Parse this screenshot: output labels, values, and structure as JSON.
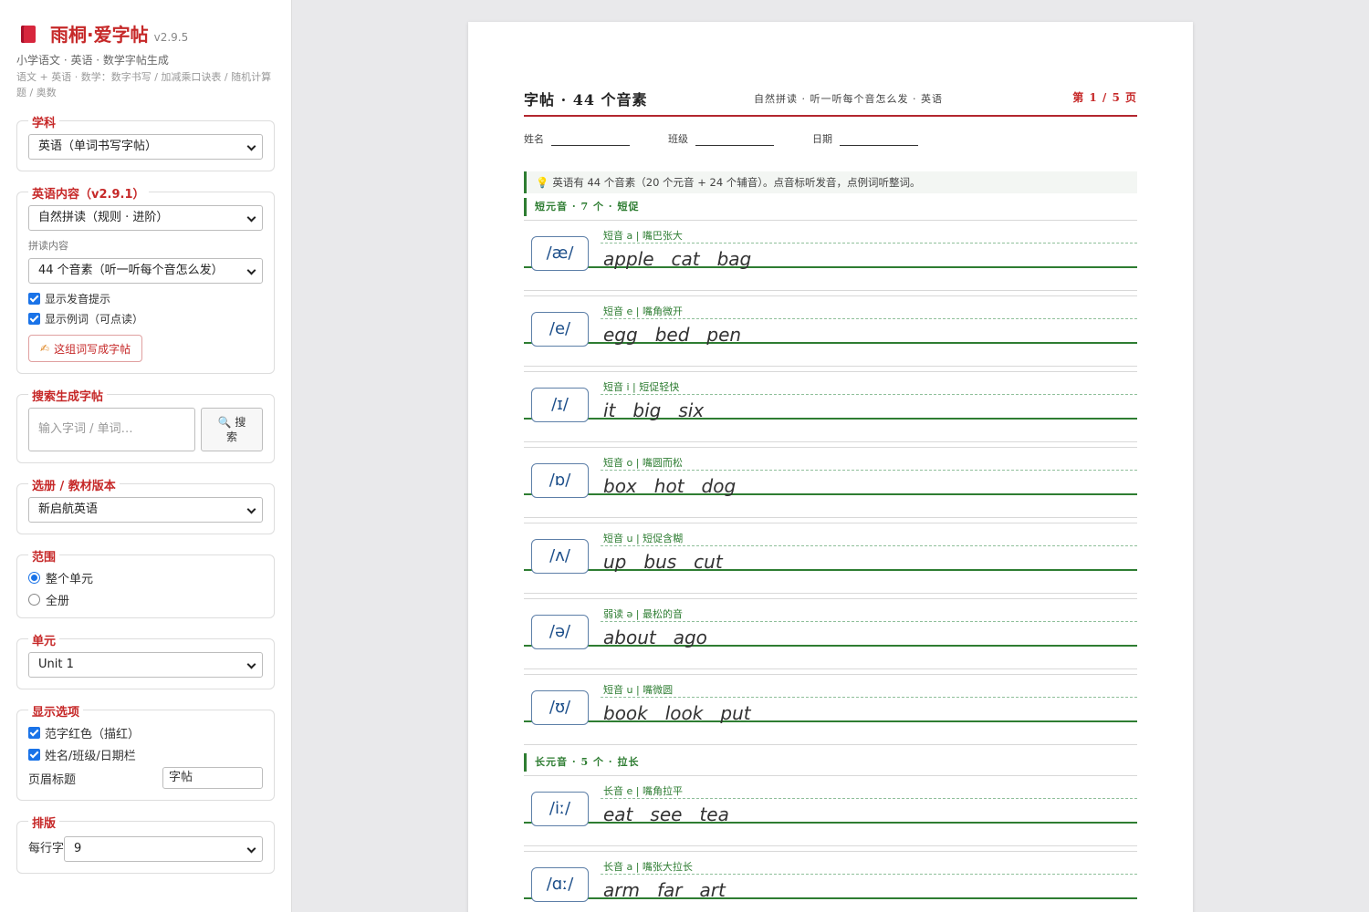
{
  "app": {
    "title": "雨桐·爱字帖",
    "version": "v2.9.5",
    "subtitle": "小学语文 · 英语 · 数学字帖生成",
    "desc": "语文 + 英语 · 数学：数字书写 / 加减乘口诀表 / 随机计算题 / 奥数"
  },
  "sidebar": {
    "subject": {
      "legend": "学科",
      "value": "英语（单词书写字帖）"
    },
    "english": {
      "legend": "英语内容（v2.9.1）",
      "mode": "自然拼读（规则 · 进阶）",
      "sub_label": "拼读内容",
      "content": "44 个音素（听一听每个音怎么发）",
      "check_hint": "显示发音提示",
      "check_examples": "显示例词（可点读）",
      "button": "这组词写成字帖"
    },
    "search": {
      "legend": "搜索生成字帖",
      "placeholder": "输入字词 / 单词…",
      "button": "🔍 搜索"
    },
    "textbook": {
      "legend": "选册 / 教材版本",
      "value": "新启航英语"
    },
    "range": {
      "legend": "范围",
      "option1": "整个单元",
      "option2": "全册"
    },
    "unit": {
      "legend": "单元",
      "value": "Unit 1"
    },
    "display": {
      "legend": "显示选项",
      "check_red": "范字红色（描红）",
      "check_name": "姓名/班级/日期栏",
      "title_label": "页眉标题",
      "title_value": "字帖"
    },
    "layout": {
      "legend": "排版",
      "perline_label": "每行字",
      "perline_value": "9"
    }
  },
  "paper": {
    "title": "字帖 · 44 个音素",
    "subtitle": "自然拼读 · 听一听每个音怎么发 · 英语",
    "page": "第 1 / 5 页",
    "fields": {
      "name": "姓名",
      "class": "班级",
      "date": "日期"
    },
    "tip": "英语有 44 个音素（20 个元音 + 24 个辅音）。点音标听发音，点例词听整词。",
    "sections": [
      {
        "title": "短元音 · 7 个 · 短促",
        "rows": [
          {
            "phoneme": "/æ/",
            "hint": "短音 a | 嘴巴张大",
            "words": [
              "apple",
              "cat",
              "bag"
            ]
          },
          {
            "phoneme": "/e/",
            "hint": "短音 e | 嘴角微开",
            "words": [
              "egg",
              "bed",
              "pen"
            ]
          },
          {
            "phoneme": "/ɪ/",
            "hint": "短音 i | 短促轻快",
            "words": [
              "it",
              "big",
              "six"
            ]
          },
          {
            "phoneme": "/ɒ/",
            "hint": "短音 o | 嘴圆而松",
            "words": [
              "box",
              "hot",
              "dog"
            ]
          },
          {
            "phoneme": "/ʌ/",
            "hint": "短音 u | 短促含糊",
            "words": [
              "up",
              "bus",
              "cut"
            ]
          },
          {
            "phoneme": "/ə/",
            "hint": "弱读 ə | 最松的音",
            "words": [
              "about",
              "ago"
            ]
          },
          {
            "phoneme": "/ʊ/",
            "hint": "短音 u | 嘴微圆",
            "words": [
              "book",
              "look",
              "put"
            ]
          }
        ]
      },
      {
        "title": "长元音 · 5 个 · 拉长",
        "rows": [
          {
            "phoneme": "/iː/",
            "hint": "长音 e | 嘴角拉平",
            "words": [
              "eat",
              "see",
              "tea"
            ]
          },
          {
            "phoneme": "/ɑː/",
            "hint": "长音 a | 嘴张大拉长",
            "words": [
              "arm",
              "far",
              "art"
            ]
          }
        ]
      }
    ]
  }
}
